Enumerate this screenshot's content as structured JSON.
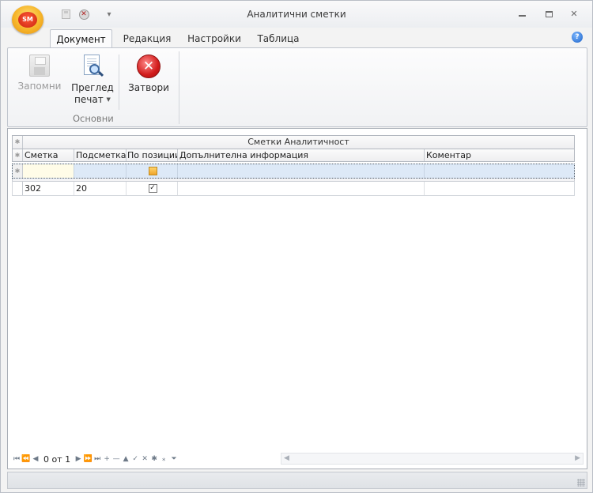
{
  "window": {
    "title": "Аналитични сметки",
    "app_logo_text": "SM"
  },
  "ribbon": {
    "tabs": [
      {
        "label": "Документ",
        "active": true
      },
      {
        "label": "Редакция",
        "active": false
      },
      {
        "label": "Настройки",
        "active": false
      },
      {
        "label": "Таблица",
        "active": false
      }
    ],
    "buttons": {
      "save": {
        "label": "Запомни",
        "enabled": false,
        "icon": "floppy-disk-icon"
      },
      "print_preview": {
        "label_line1": "Преглед",
        "label_line2": "печат",
        "icon": "print-preview-icon"
      },
      "close": {
        "label": "Затвори",
        "icon": "close-circle-icon"
      }
    },
    "group_label": "Основни"
  },
  "grid": {
    "band_title": "Сметки Аналитичност",
    "columns": [
      "Сметка",
      "Подсметка",
      "По позиции",
      "Допълнителна информация",
      "Коментар"
    ],
    "rows": [
      {
        "account": "302",
        "subaccount": "20",
        "by_position": true,
        "additional_info": "",
        "comment": ""
      }
    ]
  },
  "navigator": {
    "page_text": "0 от 1"
  },
  "colors": {
    "accent": "#2b6fd0",
    "close_red": "#d21c1c",
    "selected_row": "#dde9f7"
  }
}
